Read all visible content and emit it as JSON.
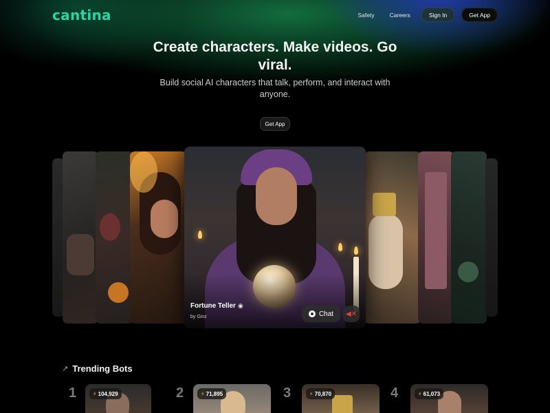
{
  "header": {
    "logo": "cantina",
    "nav": {
      "safety": "Safety",
      "careers": "Careers",
      "sign_in": "Sign In",
      "get_app": "Get App"
    }
  },
  "hero": {
    "title": "Create characters. Make videos. Go viral.",
    "subtitle": "Build social AI characters that talk, perform, and interact with anyone.",
    "cta": "Get App"
  },
  "featured": {
    "name": "Fortune Teller",
    "name_icon": "crystal-ball-icon",
    "author": "by Ginz",
    "chat_label": "Chat",
    "chat_icon": "chat-bubble-icon",
    "mute_icon": "speaker-muted-icon"
  },
  "trending": {
    "title": "Trending Bots",
    "icon": "trending-up-icon",
    "bots": [
      {
        "rank": "1",
        "count": "104,929"
      },
      {
        "rank": "2",
        "count": "71,895"
      },
      {
        "rank": "3",
        "count": "70,870"
      },
      {
        "rank": "4",
        "count": "61,073"
      }
    ]
  },
  "colors": {
    "brand": "#29d6a3",
    "background": "#000000",
    "muted_icon": "#e0443f",
    "bolt": "#f5c518"
  }
}
